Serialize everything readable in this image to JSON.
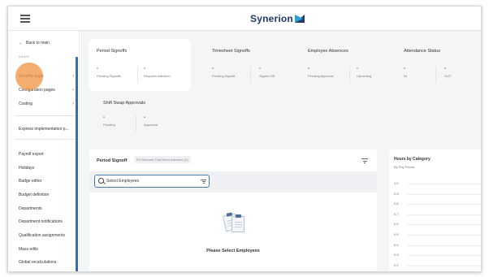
{
  "header": {
    "logo_text": "Synerion"
  },
  "sidebar": {
    "back_label": "Back to main",
    "section_label": "ADMIN",
    "items": [
      {
        "label": "Security page",
        "has_chevron": true
      },
      {
        "label": "Configuration pages",
        "has_chevron": true
      },
      {
        "label": "Costing",
        "has_chevron": true
      },
      {
        "label": "Express implementation p...",
        "has_chevron": false
      },
      {
        "label": "Payroll export",
        "has_chevron": false
      },
      {
        "label": "Holidays",
        "has_chevron": false
      },
      {
        "label": "Badge editor",
        "has_chevron": false
      },
      {
        "label": "Budget definition",
        "has_chevron": false
      },
      {
        "label": "Departments",
        "has_chevron": false
      },
      {
        "label": "Department notifications",
        "has_chevron": false
      },
      {
        "label": "Qualification assignments",
        "has_chevron": false
      },
      {
        "label": "Mass edits",
        "has_chevron": false
      },
      {
        "label": "Global recalculations",
        "has_chevron": false
      }
    ]
  },
  "tiles": {
    "period_signoffs": {
      "title": "Period Signoffs",
      "metrics": [
        {
          "value": "-",
          "label": "Pending Signoffs"
        },
        {
          "value": "-",
          "label": "Requires Attention"
        }
      ]
    },
    "timesheet_signoffs": {
      "title": "Timesheet Signoffs",
      "metrics": [
        {
          "value": "-",
          "label": "Pending Signoff"
        },
        {
          "value": "-",
          "label": "Signed Off"
        }
      ]
    },
    "employee_absences": {
      "title": "Employee Absences",
      "metrics": [
        {
          "value": "-",
          "label": "Pending Approval"
        },
        {
          "value": "-",
          "label": "Upcoming"
        }
      ]
    },
    "attendance_status": {
      "title": "Attendance Status",
      "metrics": [
        {
          "value": "-",
          "label": "IN"
        },
        {
          "value": "-",
          "label": "OUT"
        }
      ]
    },
    "shift_swap": {
      "title": "Shift Swap Approvals",
      "metrics": [
        {
          "value": "-",
          "label": "Pending"
        },
        {
          "value": "-",
          "label": "Approved"
        }
      ]
    }
  },
  "period_signoff_panel": {
    "title": "Period Signoff",
    "chip": "Fix Records That Need Attention (0)",
    "search_placeholder": "Select Employees",
    "empty_message": "Please Select Employees"
  },
  "hours_by_category": {
    "title": "Hours by Category",
    "subtitle": "By Pay Period",
    "y_ticks": [
      "1.0",
      "0.9",
      "0.8",
      "0.7",
      "0.6",
      "0.5",
      "0.4",
      "0.3",
      "0.2"
    ]
  },
  "colors": {
    "brand_navy": "#1f3a6e",
    "brand_blue": "#2a9fd8",
    "accent_scroll": "#3b6ea8",
    "highlight": "#f0964a"
  }
}
